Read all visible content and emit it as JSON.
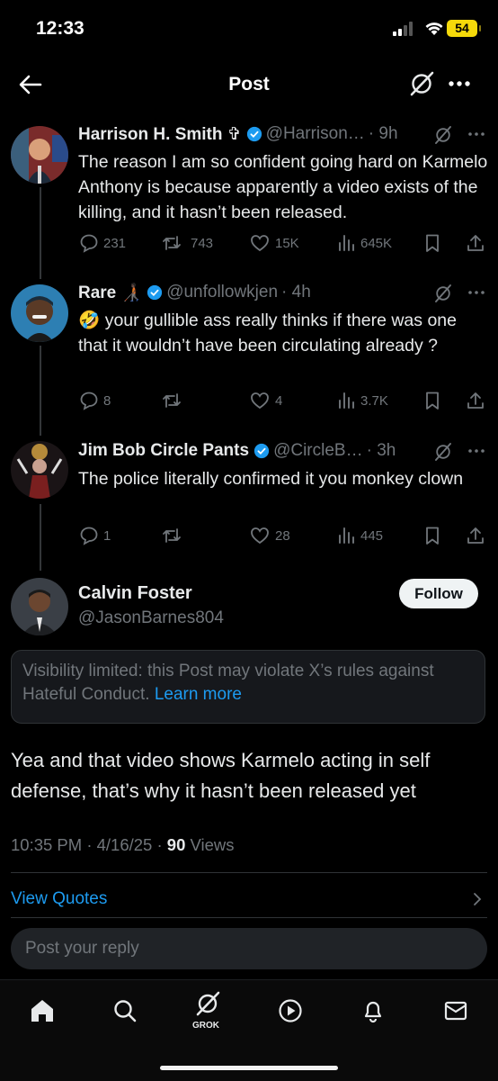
{
  "status_bar": {
    "time": "12:33",
    "battery": "54"
  },
  "nav": {
    "title": "Post"
  },
  "replies": [
    {
      "name": "Harrison H. Smith ✞",
      "handle": "@Harrison…",
      "time": "· 9h",
      "text": "The reason I am so confident going hard on Karmelo Anthony is because apparently a video exists of the killing, and it hasn’t been released.",
      "replies": "231",
      "reposts": "743",
      "likes": "15K",
      "views": "645K"
    },
    {
      "name": "Rare 🧑🏿‍🦯",
      "handle": "@unfollowkjen",
      "time": "· 4h",
      "text": "🤣 your gullible ass really thinks if there was one that it wouldn’t have been circulating already ?",
      "replies": "8",
      "reposts": "",
      "likes": "4",
      "views": "3.7K"
    },
    {
      "name": "Jim Bob Circle Pants",
      "handle": "@CircleB…",
      "time": "· 3h",
      "text": "The police literally confirmed it you monkey clown",
      "replies": "1",
      "reposts": "",
      "likes": "28",
      "views": "445"
    }
  ],
  "main_post": {
    "name": "Calvin Foster",
    "handle": "@JasonBarnes804",
    "follow_label": "Follow",
    "notice_text": "Visibility limited: this Post may violate X’s rules against Hateful Conduct.",
    "notice_link": "Learn more",
    "text": "Yea and that video shows Karmelo acting in self defense, that’s why it hasn’t been released yet",
    "time": "10:35 PM · 4/16/25 ·",
    "views_count": "90",
    "views_label": "Views"
  },
  "view_quotes": "View Quotes",
  "reply_placeholder": "Post your reply",
  "tabbar": {
    "grok_label": "GROK"
  },
  "icons": [
    "back-arrow-icon",
    "grok-icon",
    "more-icon",
    "verified-icon",
    "reply-icon",
    "repost-icon",
    "like-icon",
    "views-icon",
    "bookmark-icon",
    "share-icon",
    "home-icon",
    "search-icon",
    "play-icon",
    "bell-icon",
    "mail-icon"
  ],
  "colors": {
    "accent": "#1d9bf0",
    "muted": "#71767b",
    "text": "#e7e9ea",
    "battery": "#f5d90a"
  }
}
